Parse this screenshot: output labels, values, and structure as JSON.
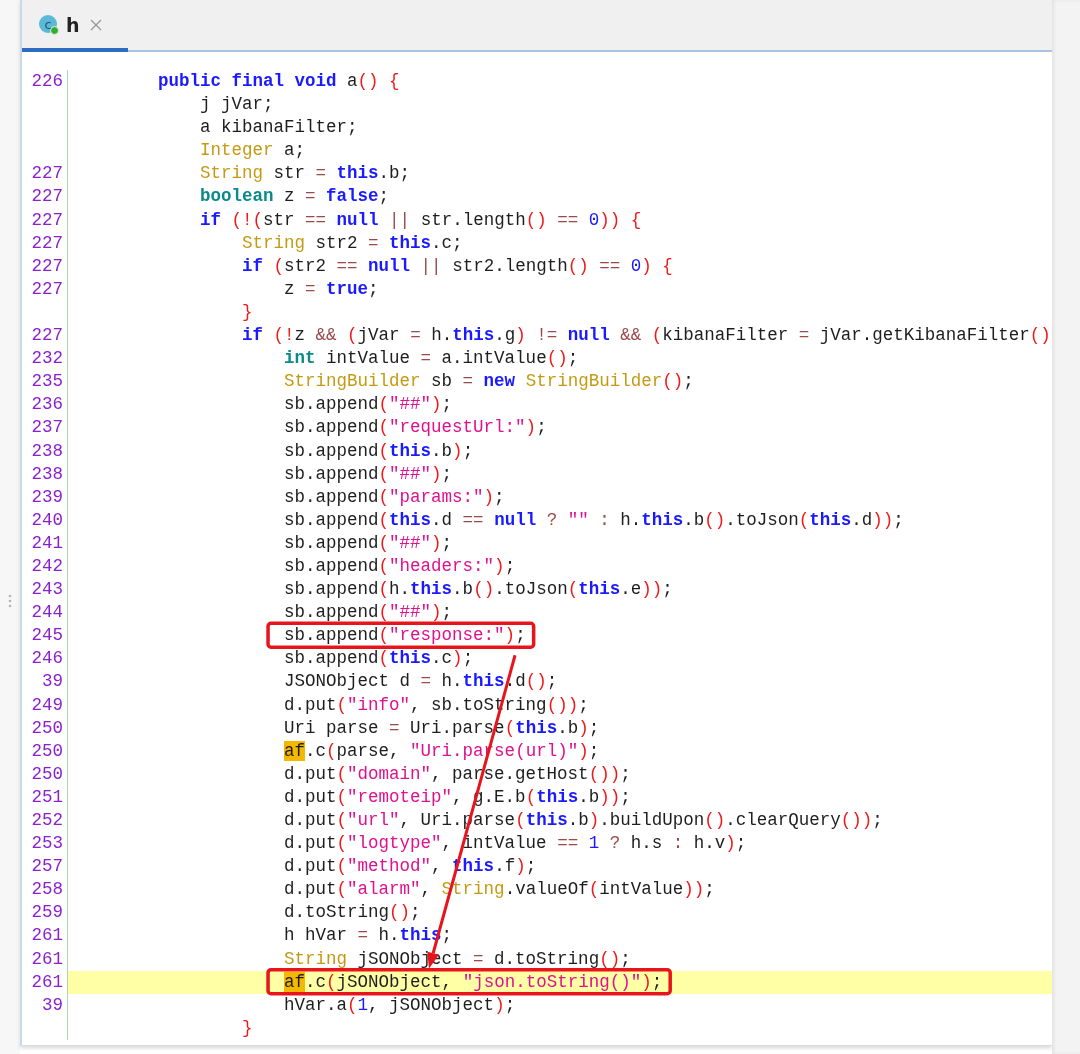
{
  "tabs": [
    {
      "label": "h",
      "icon_letter": "c",
      "selected": true
    }
  ],
  "lines": [
    {
      "num": "226",
      "current": false,
      "boxed": false,
      "tokens": [
        {
          "kind": "k",
          "text": "        public final void"
        },
        {
          "kind": "p",
          "text": " a"
        },
        {
          "kind": "b",
          "text": "()"
        },
        {
          "kind": "b",
          "text": " {"
        }
      ]
    },
    {
      "current": false,
      "boxed": false,
      "tokens": [
        {
          "kind": "p",
          "text": "            j jVar;"
        }
      ]
    },
    {
      "current": false,
      "boxed": false,
      "tokens": [
        {
          "kind": "p",
          "text": "            a kibanaFilter;"
        }
      ]
    },
    {
      "current": false,
      "boxed": false,
      "tokens": [
        {
          "kind": "t",
          "text": "            Integer"
        },
        {
          "kind": "p",
          "text": " a;"
        }
      ]
    },
    {
      "num": "227",
      "current": false,
      "boxed": false,
      "tokens": [
        {
          "kind": "t",
          "text": "            String"
        },
        {
          "kind": "p",
          "text": " str "
        },
        {
          "kind": "o",
          "text": "="
        },
        {
          "kind": "k",
          "text": " this"
        },
        {
          "kind": "p",
          "text": ".b;"
        }
      ]
    },
    {
      "num": "227",
      "current": false,
      "boxed": false,
      "tokens": [
        {
          "kind": "v",
          "text": "            boolean"
        },
        {
          "kind": "p",
          "text": " z "
        },
        {
          "kind": "o",
          "text": "="
        },
        {
          "kind": "k",
          "text": " false"
        },
        {
          "kind": "p",
          "text": ";"
        }
      ]
    },
    {
      "num": "227",
      "current": false,
      "boxed": false,
      "tokens": [
        {
          "kind": "k",
          "text": "            if"
        },
        {
          "kind": "b",
          "text": " (!("
        },
        {
          "kind": "p",
          "text": "str "
        },
        {
          "kind": "o",
          "text": "=="
        },
        {
          "kind": "k",
          "text": " null"
        },
        {
          "kind": "o",
          "text": " ||"
        },
        {
          "kind": "p",
          "text": " str.length"
        },
        {
          "kind": "b",
          "text": "()"
        },
        {
          "kind": "o",
          "text": " =="
        },
        {
          "kind": "n",
          "text": " 0"
        },
        {
          "kind": "b",
          "text": "))"
        },
        {
          "kind": "b",
          "text": " {"
        }
      ]
    },
    {
      "num": "227",
      "current": false,
      "boxed": false,
      "tokens": [
        {
          "kind": "t",
          "text": "                String"
        },
        {
          "kind": "p",
          "text": " str2 "
        },
        {
          "kind": "o",
          "text": "="
        },
        {
          "kind": "k",
          "text": " this"
        },
        {
          "kind": "p",
          "text": ".c;"
        }
      ]
    },
    {
      "num": "227",
      "current": false,
      "boxed": false,
      "tokens": [
        {
          "kind": "k",
          "text": "                if"
        },
        {
          "kind": "b",
          "text": " ("
        },
        {
          "kind": "p",
          "text": "str2 "
        },
        {
          "kind": "o",
          "text": "=="
        },
        {
          "kind": "k",
          "text": " null"
        },
        {
          "kind": "o",
          "text": " ||"
        },
        {
          "kind": "p",
          "text": " str2.length"
        },
        {
          "kind": "b",
          "text": "()"
        },
        {
          "kind": "o",
          "text": " =="
        },
        {
          "kind": "n",
          "text": " 0"
        },
        {
          "kind": "b",
          "text": ")"
        },
        {
          "kind": "b",
          "text": " {"
        }
      ]
    },
    {
      "num": "227",
      "current": false,
      "boxed": false,
      "tokens": [
        {
          "kind": "p",
          "text": "                    z "
        },
        {
          "kind": "o",
          "text": "="
        },
        {
          "kind": "k",
          "text": " true"
        },
        {
          "kind": "p",
          "text": ";"
        }
      ]
    },
    {
      "current": false,
      "boxed": false,
      "tokens": [
        {
          "kind": "b",
          "text": "                }"
        }
      ]
    },
    {
      "num": "227",
      "current": false,
      "boxed": false,
      "tokens": [
        {
          "kind": "k",
          "text": "                if"
        },
        {
          "kind": "b",
          "text": " (!"
        },
        {
          "kind": "p",
          "text": "z "
        },
        {
          "kind": "o",
          "text": "&&"
        },
        {
          "kind": "b",
          "text": " ("
        },
        {
          "kind": "p",
          "text": "jVar "
        },
        {
          "kind": "o",
          "text": "="
        },
        {
          "kind": "p",
          "text": " h."
        },
        {
          "kind": "k",
          "text": "this"
        },
        {
          "kind": "p",
          "text": ".g"
        },
        {
          "kind": "b",
          "text": ")"
        },
        {
          "kind": "o",
          "text": " !="
        },
        {
          "kind": "k",
          "text": " null"
        },
        {
          "kind": "o",
          "text": " &&"
        },
        {
          "kind": "b",
          "text": " ("
        },
        {
          "kind": "p",
          "text": "kibanaFilter "
        },
        {
          "kind": "o",
          "text": "="
        },
        {
          "kind": "p",
          "text": " jVar.getKibanaFilter"
        },
        {
          "kind": "b",
          "text": "()"
        }
      ]
    },
    {
      "num": "232",
      "current": false,
      "boxed": false,
      "tokens": [
        {
          "kind": "v",
          "text": "                    int"
        },
        {
          "kind": "p",
          "text": " intValue "
        },
        {
          "kind": "o",
          "text": "="
        },
        {
          "kind": "p",
          "text": " a.intValue"
        },
        {
          "kind": "b",
          "text": "()"
        },
        {
          "kind": "p",
          "text": ";"
        }
      ]
    },
    {
      "num": "235",
      "current": false,
      "boxed": false,
      "tokens": [
        {
          "kind": "t",
          "text": "                    StringBuilder"
        },
        {
          "kind": "p",
          "text": " sb "
        },
        {
          "kind": "o",
          "text": "="
        },
        {
          "kind": "k",
          "text": " new"
        },
        {
          "kind": "t",
          "text": " StringBuilder"
        },
        {
          "kind": "b",
          "text": "()"
        },
        {
          "kind": "p",
          "text": ";"
        }
      ]
    },
    {
      "num": "236",
      "current": false,
      "boxed": false,
      "tokens": [
        {
          "kind": "p",
          "text": "                    sb.append"
        },
        {
          "kind": "b",
          "text": "("
        },
        {
          "kind": "s",
          "text": "\"##\""
        },
        {
          "kind": "b",
          "text": ")"
        },
        {
          "kind": "p",
          "text": ";"
        }
      ]
    },
    {
      "num": "237",
      "current": false,
      "boxed": false,
      "tokens": [
        {
          "kind": "p",
          "text": "                    sb.append"
        },
        {
          "kind": "b",
          "text": "("
        },
        {
          "kind": "s",
          "text": "\"requestUrl:\""
        },
        {
          "kind": "b",
          "text": ")"
        },
        {
          "kind": "p",
          "text": ";"
        }
      ]
    },
    {
      "num": "238",
      "current": false,
      "boxed": false,
      "tokens": [
        {
          "kind": "p",
          "text": "                    sb.append"
        },
        {
          "kind": "b",
          "text": "("
        },
        {
          "kind": "k",
          "text": "this"
        },
        {
          "kind": "p",
          "text": ".b"
        },
        {
          "kind": "b",
          "text": ")"
        },
        {
          "kind": "p",
          "text": ";"
        }
      ]
    },
    {
      "num": "238",
      "current": false,
      "boxed": false,
      "tokens": [
        {
          "kind": "p",
          "text": "                    sb.append"
        },
        {
          "kind": "b",
          "text": "("
        },
        {
          "kind": "s",
          "text": "\"##\""
        },
        {
          "kind": "b",
          "text": ")"
        },
        {
          "kind": "p",
          "text": ";"
        }
      ]
    },
    {
      "num": "239",
      "current": false,
      "boxed": false,
      "tokens": [
        {
          "kind": "p",
          "text": "                    sb.append"
        },
        {
          "kind": "b",
          "text": "("
        },
        {
          "kind": "s",
          "text": "\"params:\""
        },
        {
          "kind": "b",
          "text": ")"
        },
        {
          "kind": "p",
          "text": ";"
        }
      ]
    },
    {
      "num": "240",
      "current": false,
      "boxed": false,
      "tokens": [
        {
          "kind": "p",
          "text": "                    sb.append"
        },
        {
          "kind": "b",
          "text": "("
        },
        {
          "kind": "k",
          "text": "this"
        },
        {
          "kind": "p",
          "text": ".d "
        },
        {
          "kind": "o",
          "text": "=="
        },
        {
          "kind": "k",
          "text": " null"
        },
        {
          "kind": "o",
          "text": " ?"
        },
        {
          "kind": "s",
          "text": " \"\""
        },
        {
          "kind": "o",
          "text": " :"
        },
        {
          "kind": "p",
          "text": " h."
        },
        {
          "kind": "k",
          "text": "this"
        },
        {
          "kind": "p",
          "text": ".b"
        },
        {
          "kind": "b",
          "text": "()"
        },
        {
          "kind": "p",
          "text": ".toJson"
        },
        {
          "kind": "b",
          "text": "("
        },
        {
          "kind": "k",
          "text": "this"
        },
        {
          "kind": "p",
          "text": ".d"
        },
        {
          "kind": "b",
          "text": "))"
        },
        {
          "kind": "p",
          "text": ";"
        }
      ]
    },
    {
      "num": "241",
      "current": false,
      "boxed": false,
      "tokens": [
        {
          "kind": "p",
          "text": "                    sb.append"
        },
        {
          "kind": "b",
          "text": "("
        },
        {
          "kind": "s",
          "text": "\"##\""
        },
        {
          "kind": "b",
          "text": ")"
        },
        {
          "kind": "p",
          "text": ";"
        }
      ]
    },
    {
      "num": "242",
      "current": false,
      "boxed": false,
      "tokens": [
        {
          "kind": "p",
          "text": "                    sb.append"
        },
        {
          "kind": "b",
          "text": "("
        },
        {
          "kind": "s",
          "text": "\"headers:\""
        },
        {
          "kind": "b",
          "text": ")"
        },
        {
          "kind": "p",
          "text": ";"
        }
      ]
    },
    {
      "num": "243",
      "current": false,
      "boxed": false,
      "tokens": [
        {
          "kind": "p",
          "text": "                    sb.append"
        },
        {
          "kind": "b",
          "text": "("
        },
        {
          "kind": "p",
          "text": "h."
        },
        {
          "kind": "k",
          "text": "this"
        },
        {
          "kind": "p",
          "text": ".b"
        },
        {
          "kind": "b",
          "text": "()"
        },
        {
          "kind": "p",
          "text": ".toJson"
        },
        {
          "kind": "b",
          "text": "("
        },
        {
          "kind": "k",
          "text": "this"
        },
        {
          "kind": "p",
          "text": ".e"
        },
        {
          "kind": "b",
          "text": "))"
        },
        {
          "kind": "p",
          "text": ";"
        }
      ]
    },
    {
      "num": "244",
      "current": false,
      "boxed": false,
      "tokens": [
        {
          "kind": "p",
          "text": "                    sb.append"
        },
        {
          "kind": "b",
          "text": "("
        },
        {
          "kind": "s",
          "text": "\"##\""
        },
        {
          "kind": "b",
          "text": ")"
        },
        {
          "kind": "p",
          "text": ";"
        }
      ]
    },
    {
      "num": "245",
      "current": false,
      "boxed": true,
      "tokens": [
        {
          "kind": "p",
          "text": "                    sb.append"
        },
        {
          "kind": "b",
          "text": "("
        },
        {
          "kind": "s",
          "text": "\"response:\""
        },
        {
          "kind": "b",
          "text": ")"
        },
        {
          "kind": "p",
          "text": ";"
        }
      ]
    },
    {
      "num": "246",
      "current": false,
      "boxed": false,
      "tokens": [
        {
          "kind": "p",
          "text": "                    sb.append"
        },
        {
          "kind": "b",
          "text": "("
        },
        {
          "kind": "k",
          "text": "this"
        },
        {
          "kind": "p",
          "text": ".c"
        },
        {
          "kind": "b",
          "text": ")"
        },
        {
          "kind": "p",
          "text": ";"
        }
      ]
    },
    {
      "num": "39",
      "current": false,
      "boxed": false,
      "tokens": [
        {
          "kind": "p",
          "text": "                    JSONObject d "
        },
        {
          "kind": "o",
          "text": "="
        },
        {
          "kind": "p",
          "text": " h."
        },
        {
          "kind": "k",
          "text": "this"
        },
        {
          "kind": "p",
          "text": ".d"
        },
        {
          "kind": "b",
          "text": "()"
        },
        {
          "kind": "p",
          "text": ";"
        }
      ]
    },
    {
      "num": "249",
      "current": false,
      "boxed": false,
      "tokens": [
        {
          "kind": "p",
          "text": "                    d.put"
        },
        {
          "kind": "b",
          "text": "("
        },
        {
          "kind": "s",
          "text": "\"info\""
        },
        {
          "kind": "p",
          "text": ", sb.toString"
        },
        {
          "kind": "b",
          "text": "())"
        },
        {
          "kind": "p",
          "text": ";"
        }
      ]
    },
    {
      "num": "250",
      "current": false,
      "boxed": false,
      "tokens": [
        {
          "kind": "p",
          "text": "                    Uri parse "
        },
        {
          "kind": "o",
          "text": "="
        },
        {
          "kind": "p",
          "text": " Uri.parse"
        },
        {
          "kind": "b",
          "text": "("
        },
        {
          "kind": "k",
          "text": "this"
        },
        {
          "kind": "p",
          "text": ".b"
        },
        {
          "kind": "b",
          "text": ")"
        },
        {
          "kind": "p",
          "text": ";"
        }
      ]
    },
    {
      "num": "250",
      "current": false,
      "boxed": false,
      "tokens": [
        {
          "kind": "m",
          "text": "                    af"
        },
        {
          "kind": "p",
          "text": ".c"
        },
        {
          "kind": "b",
          "text": "("
        },
        {
          "kind": "p",
          "text": "parse, "
        },
        {
          "kind": "s",
          "text": "\"Uri.parse(url)\""
        },
        {
          "kind": "b",
          "text": ")"
        },
        {
          "kind": "p",
          "text": ";"
        }
      ]
    },
    {
      "num": "250",
      "current": false,
      "boxed": false,
      "tokens": [
        {
          "kind": "p",
          "text": "                    d.put"
        },
        {
          "kind": "b",
          "text": "("
        },
        {
          "kind": "s",
          "text": "\"domain\""
        },
        {
          "kind": "p",
          "text": ", parse.getHost"
        },
        {
          "kind": "b",
          "text": "())"
        },
        {
          "kind": "p",
          "text": ";"
        }
      ]
    },
    {
      "num": "251",
      "current": false,
      "boxed": false,
      "tokens": [
        {
          "kind": "p",
          "text": "                    d.put"
        },
        {
          "kind": "b",
          "text": "("
        },
        {
          "kind": "s",
          "text": "\"remoteip\""
        },
        {
          "kind": "p",
          "text": ", g.E.b"
        },
        {
          "kind": "b",
          "text": "("
        },
        {
          "kind": "k",
          "text": "this"
        },
        {
          "kind": "p",
          "text": ".b"
        },
        {
          "kind": "b",
          "text": "))"
        },
        {
          "kind": "p",
          "text": ";"
        }
      ]
    },
    {
      "num": "252",
      "current": false,
      "boxed": false,
      "tokens": [
        {
          "kind": "p",
          "text": "                    d.put"
        },
        {
          "kind": "b",
          "text": "("
        },
        {
          "kind": "s",
          "text": "\"url\""
        },
        {
          "kind": "p",
          "text": ", Uri.parse"
        },
        {
          "kind": "b",
          "text": "("
        },
        {
          "kind": "k",
          "text": "this"
        },
        {
          "kind": "p",
          "text": ".b"
        },
        {
          "kind": "b",
          "text": ")"
        },
        {
          "kind": "p",
          "text": ".buildUpon"
        },
        {
          "kind": "b",
          "text": "()"
        },
        {
          "kind": "p",
          "text": ".clearQuery"
        },
        {
          "kind": "b",
          "text": "())"
        },
        {
          "kind": "p",
          "text": ";"
        }
      ]
    },
    {
      "num": "253",
      "current": false,
      "boxed": false,
      "tokens": [
        {
          "kind": "p",
          "text": "                    d.put"
        },
        {
          "kind": "b",
          "text": "("
        },
        {
          "kind": "s",
          "text": "\"logtype\""
        },
        {
          "kind": "p",
          "text": ", intValue "
        },
        {
          "kind": "o",
          "text": "=="
        },
        {
          "kind": "n",
          "text": " 1"
        },
        {
          "kind": "o",
          "text": " ?"
        },
        {
          "kind": "p",
          "text": " h.s "
        },
        {
          "kind": "o",
          "text": ":"
        },
        {
          "kind": "p",
          "text": " h.v"
        },
        {
          "kind": "b",
          "text": ")"
        },
        {
          "kind": "p",
          "text": ";"
        }
      ]
    },
    {
      "num": "257",
      "current": false,
      "boxed": false,
      "tokens": [
        {
          "kind": "p",
          "text": "                    d.put"
        },
        {
          "kind": "b",
          "text": "("
        },
        {
          "kind": "s",
          "text": "\"method\""
        },
        {
          "kind": "p",
          "text": ","
        },
        {
          "kind": "k",
          "text": " this"
        },
        {
          "kind": "p",
          "text": ".f"
        },
        {
          "kind": "b",
          "text": ")"
        },
        {
          "kind": "p",
          "text": ";"
        }
      ]
    },
    {
      "num": "258",
      "current": false,
      "boxed": false,
      "tokens": [
        {
          "kind": "p",
          "text": "                    d.put"
        },
        {
          "kind": "b",
          "text": "("
        },
        {
          "kind": "s",
          "text": "\"alarm\""
        },
        {
          "kind": "p",
          "text": ","
        },
        {
          "kind": "t",
          "text": " String"
        },
        {
          "kind": "p",
          "text": ".valueOf"
        },
        {
          "kind": "b",
          "text": "("
        },
        {
          "kind": "p",
          "text": "intValue"
        },
        {
          "kind": "b",
          "text": "))"
        },
        {
          "kind": "p",
          "text": ";"
        }
      ]
    },
    {
      "num": "259",
      "current": false,
      "boxed": false,
      "tokens": [
        {
          "kind": "p",
          "text": "                    d.toString"
        },
        {
          "kind": "b",
          "text": "()"
        },
        {
          "kind": "p",
          "text": ";"
        }
      ]
    },
    {
      "num": "261",
      "current": false,
      "boxed": false,
      "tokens": [
        {
          "kind": "p",
          "text": "                    h hVar "
        },
        {
          "kind": "o",
          "text": "="
        },
        {
          "kind": "p",
          "text": " h."
        },
        {
          "kind": "k",
          "text": "this"
        },
        {
          "kind": "p",
          "text": ";"
        }
      ]
    },
    {
      "num": "261",
      "current": false,
      "boxed": false,
      "tokens": [
        {
          "kind": "t",
          "text": "                    String"
        },
        {
          "kind": "p",
          "text": " jSONObject "
        },
        {
          "kind": "o",
          "text": "="
        },
        {
          "kind": "p",
          "text": " d.toString"
        },
        {
          "kind": "b",
          "text": "()"
        },
        {
          "kind": "p",
          "text": ";"
        }
      ]
    },
    {
      "num": "261",
      "current": true,
      "boxed": true,
      "tokens": [
        {
          "kind": "m",
          "text": "                    af"
        },
        {
          "kind": "p",
          "text": ".c"
        },
        {
          "kind": "b",
          "text": "("
        },
        {
          "kind": "p",
          "text": "jSONObject, "
        },
        {
          "kind": "s",
          "text": "\"json.toString()\""
        },
        {
          "kind": "b",
          "text": ")"
        },
        {
          "kind": "p",
          "text": ";"
        }
      ]
    },
    {
      "num": "39",
      "current": false,
      "boxed": false,
      "tokens": [
        {
          "kind": "p",
          "text": "                    hVar.a"
        },
        {
          "kind": "b",
          "text": "("
        },
        {
          "kind": "n",
          "text": "1"
        },
        {
          "kind": "p",
          "text": ", jSONObject"
        },
        {
          "kind": "b",
          "text": ")"
        },
        {
          "kind": "p",
          "text": ";"
        }
      ]
    },
    {
      "current": false,
      "boxed": false,
      "tokens": [
        {
          "kind": "b",
          "text": "                }"
        }
      ]
    }
  ]
}
